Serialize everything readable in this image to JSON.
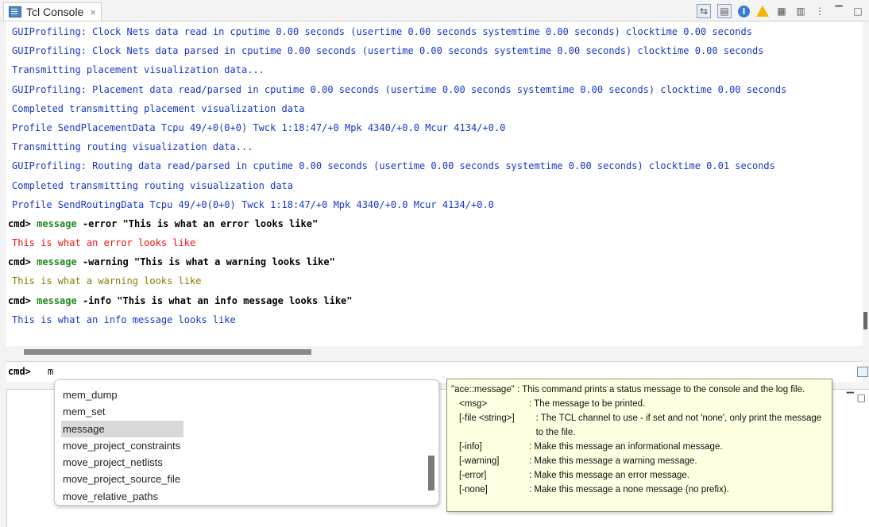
{
  "tab": {
    "title": "Tcl Console",
    "close": "×"
  },
  "toolbar": {
    "icons": [
      "pin-console-icon",
      "open-console-icon",
      "info-filter-icon",
      "warning-filter-icon",
      "clear-console-icon",
      "view-menu-icon",
      "more-icon"
    ]
  },
  "console_lines": [
    {
      "type": "out",
      "text": "GUIProfiling: Clock Nets data read in cputime 0.00 seconds (usertime 0.00 seconds systemtime 0.00 seconds) clocktime 0.00 seconds"
    },
    {
      "type": "out",
      "text": "GUIProfiling: Clock Nets data parsed in cputime 0.00 seconds (usertime 0.00 seconds systemtime 0.00 seconds) clocktime 0.00 seconds"
    },
    {
      "type": "out",
      "text": "Transmitting placement visualization data..."
    },
    {
      "type": "out",
      "text": "GUIProfiling: Placement data read/parsed in cputime 0.00 seconds (usertime 0.00 seconds systemtime 0.00 seconds) clocktime 0.00 seconds"
    },
    {
      "type": "out",
      "text": "Completed transmitting placement visualization data"
    },
    {
      "type": "out",
      "text": "Profile SendPlacementData Tcpu 49/+0(0+0) Twck 1:18:47/+0 Mpk 4340/+0.0 Mcur 4134/+0.0"
    },
    {
      "type": "out",
      "text": "Transmitting routing visualization data..."
    },
    {
      "type": "out",
      "text": "GUIProfiling: Routing data read/parsed in cputime 0.00 seconds (usertime 0.00 seconds systemtime 0.00 seconds) clocktime 0.01 seconds"
    },
    {
      "type": "out",
      "text": "Completed transmitting routing visualization data"
    },
    {
      "type": "out",
      "text": "Profile SendRoutingData Tcpu 49/+0(0+0) Twck 1:18:47/+0 Mpk 4340/+0.0 Mcur 4134/+0.0"
    }
  ],
  "commands": [
    {
      "prompt": "cmd>",
      "keyword": "message",
      "args": "-error \"This is what an error looks like\"",
      "result": "This is what an error looks like"
    },
    {
      "prompt": "cmd>",
      "keyword": "message",
      "args": "-warning \"This is what a warning looks like\"",
      "result": "This is what a warning looks like"
    },
    {
      "prompt": "cmd>",
      "keyword": "message",
      "args": "-info \"This is what an info message looks like\"",
      "result": "This is what an info message looks like"
    }
  ],
  "input": {
    "prompt": "cmd>",
    "value": "m"
  },
  "autocomplete": {
    "items": [
      "mem_dump",
      "mem_set",
      "message",
      "move_project_constraints",
      "move_project_netlists",
      "move_project_source_file",
      "move_relative_paths"
    ],
    "selected": "message"
  },
  "tooltip": {
    "header": "\"ace::message\" : This command prints a status message to the console and the log file.",
    "params": [
      {
        "name": "<msg>",
        "desc": ": The message to be printed."
      },
      {
        "name": "[-file <string>]",
        "desc": ": The TCL channel to use - if set and not 'none', only print the message to the file."
      },
      {
        "name": "[-info]",
        "desc": ": Make this message an informational message."
      },
      {
        "name": "[-warning]",
        "desc": ": Make this message a warning message."
      },
      {
        "name": "[-error]",
        "desc": ": Make this message an error message."
      },
      {
        "name": "[-none]",
        "desc": ": Make this message a none message (no prefix)."
      }
    ]
  },
  "colors": {
    "output": "#1a36c6",
    "error": "#ee1111",
    "warning": "#8a7a00",
    "keyword": "#1e8a1e"
  }
}
